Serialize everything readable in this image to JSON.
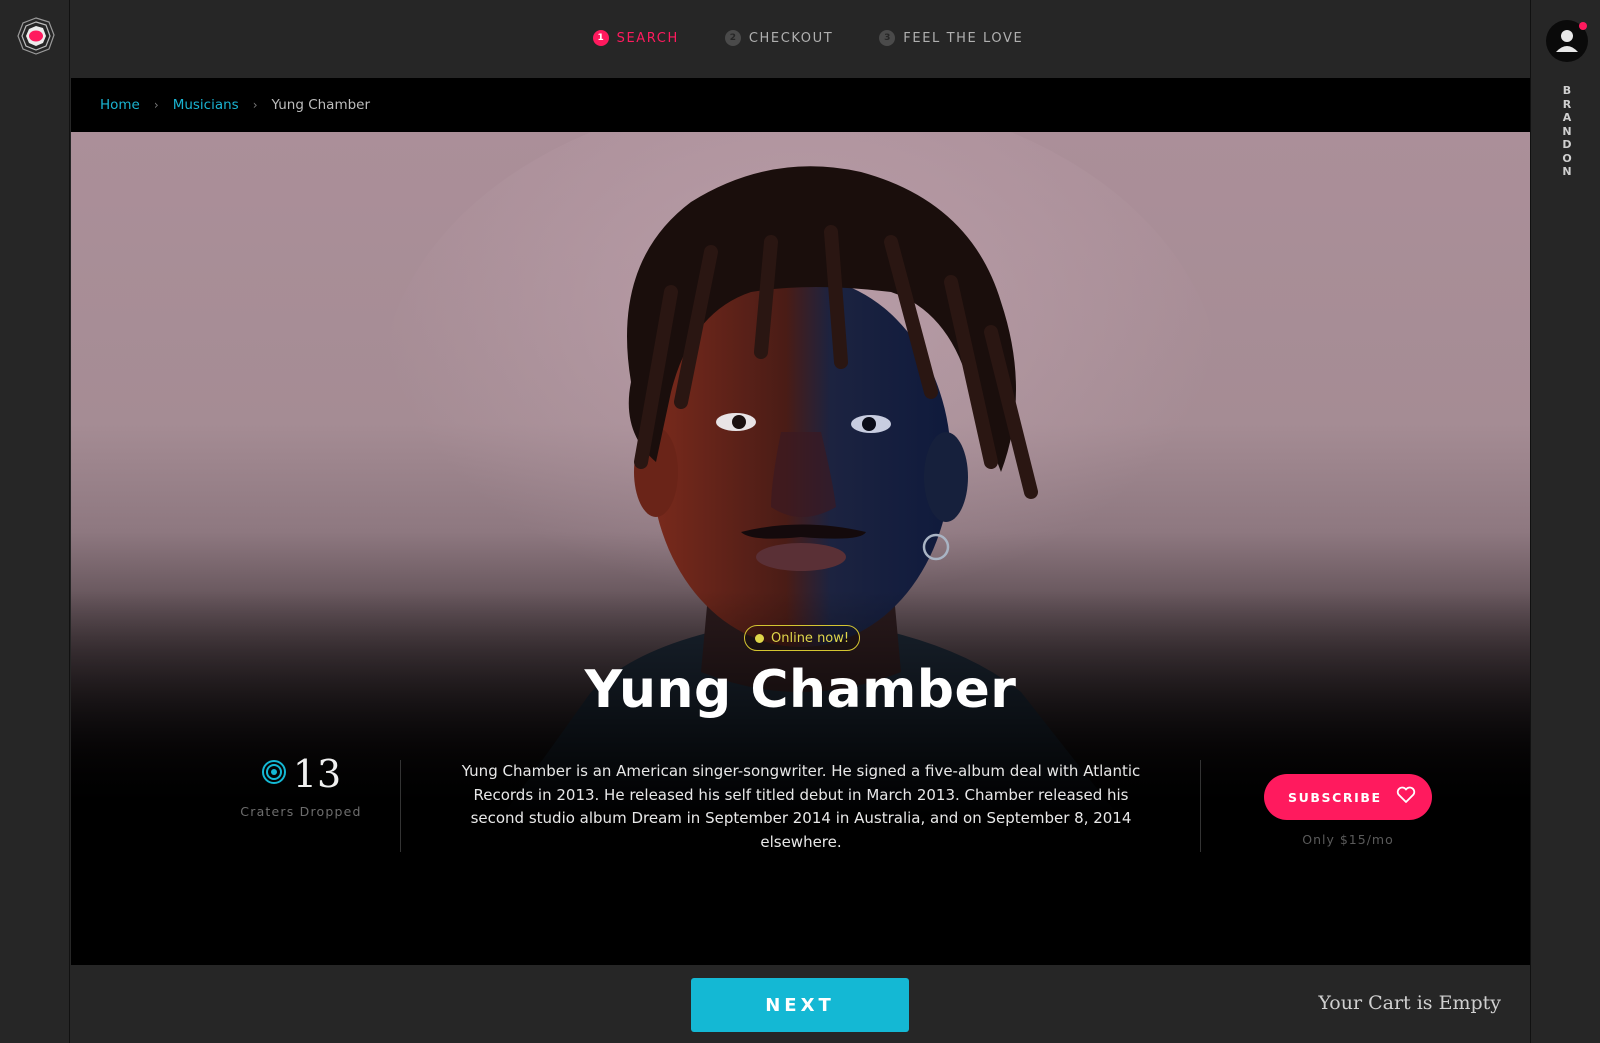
{
  "steps": [
    {
      "num": "1",
      "label": "SEARCH",
      "active": true
    },
    {
      "num": "2",
      "label": "CHECKOUT",
      "active": false
    },
    {
      "num": "3",
      "label": "FEEL THE LOVE",
      "active": false
    }
  ],
  "user": {
    "name": "BRANDON"
  },
  "breadcrumb": {
    "home": "Home",
    "section": "Musicians",
    "current": "Yung Chamber",
    "separator": "›"
  },
  "artist": {
    "status": "Online now!",
    "name": "Yung Chamber",
    "bio": "Yung Chamber is an American singer-songwriter. He signed a five-album deal with Atlantic Records in 2013. He released his self titled debut in March 2013. Chamber released his second studio album Dream in September 2014 in Australia, and on September 8, 2014 elsewhere.",
    "craters_count": "13",
    "craters_label": "Craters Dropped"
  },
  "subscribe": {
    "label": "SUBSCRIBE",
    "price": "Only $15/mo"
  },
  "footer": {
    "next_label": "NEXT",
    "cart_text": "Your Cart is Empty"
  },
  "colors": {
    "accent": "#ff1a5e",
    "teal": "#14b8d4",
    "online": "#e0d64a"
  },
  "icons": {
    "logo": "crater-logo-icon",
    "avatar": "user-avatar-icon",
    "heart": "heart-icon",
    "crater": "crater-icon"
  }
}
